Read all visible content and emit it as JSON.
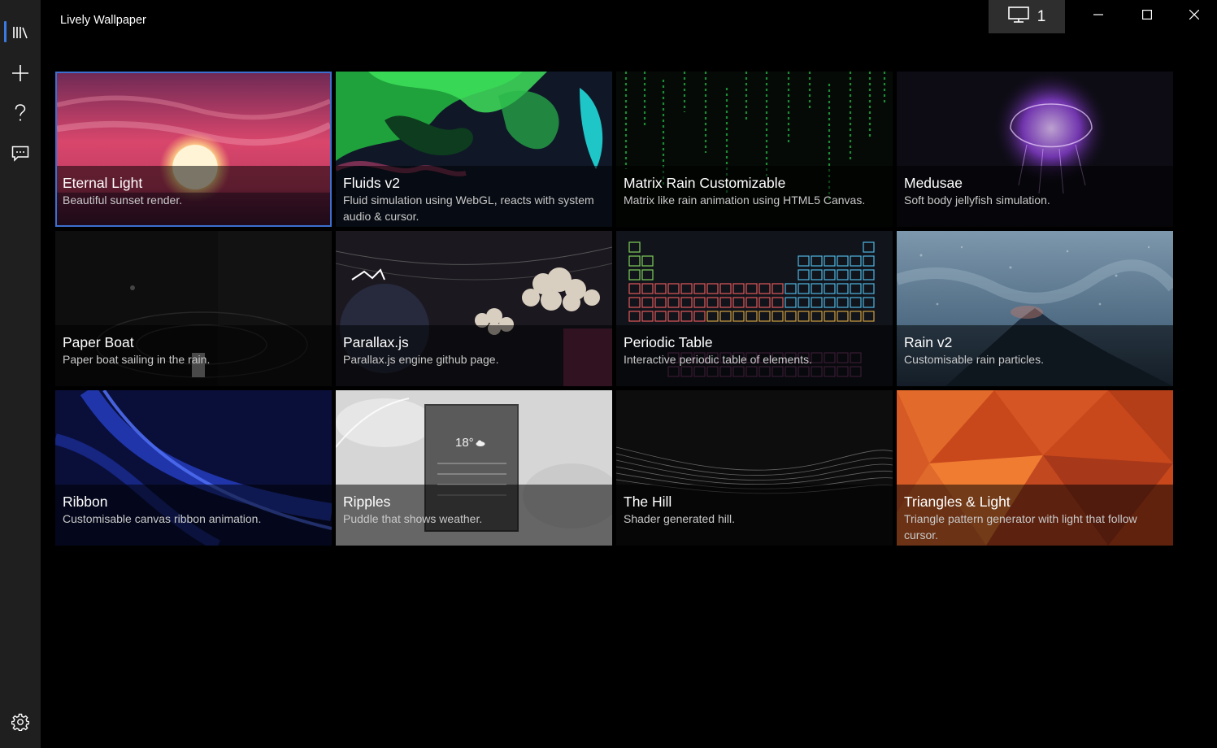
{
  "app": {
    "title": "Lively Wallpaper"
  },
  "titlebar": {
    "monitor_count": "1"
  },
  "sidebar": {
    "items": [
      {
        "name": "library",
        "icon": "library-icon"
      },
      {
        "name": "add",
        "icon": "plus-icon"
      },
      {
        "name": "help",
        "icon": "help-icon"
      },
      {
        "name": "feedback",
        "icon": "feedback-icon"
      }
    ],
    "settings_icon": "gear-icon"
  },
  "accent_color": "#3c6fd0",
  "library": {
    "tiles": [
      {
        "title": "Eternal Light",
        "desc": "Beautiful sunset render.",
        "selected": true
      },
      {
        "title": "Fluids v2",
        "desc": "Fluid simulation using WebGL, reacts with system audio & cursor."
      },
      {
        "title": "Matrix Rain Customizable",
        "desc": "Matrix like rain animation using HTML5 Canvas."
      },
      {
        "title": "Medusae",
        "desc": "Soft body jellyfish simulation."
      },
      {
        "title": "Paper Boat",
        "desc": "Paper boat sailing in the rain."
      },
      {
        "title": "Parallax.js",
        "desc": "Parallax.js engine github page."
      },
      {
        "title": "Periodic Table",
        "desc": "Interactive periodic table of elements."
      },
      {
        "title": "Rain v2",
        "desc": "Customisable rain particles."
      },
      {
        "title": "Ribbon",
        "desc": "Customisable canvas ribbon animation."
      },
      {
        "title": "Ripples",
        "desc": "Puddle that shows weather."
      },
      {
        "title": "The Hill",
        "desc": "Shader generated hill."
      },
      {
        "title": "Triangles & Light",
        "desc": "Triangle pattern generator with light that follow cursor."
      }
    ]
  },
  "ripples_preview": {
    "temperature": "18°"
  }
}
